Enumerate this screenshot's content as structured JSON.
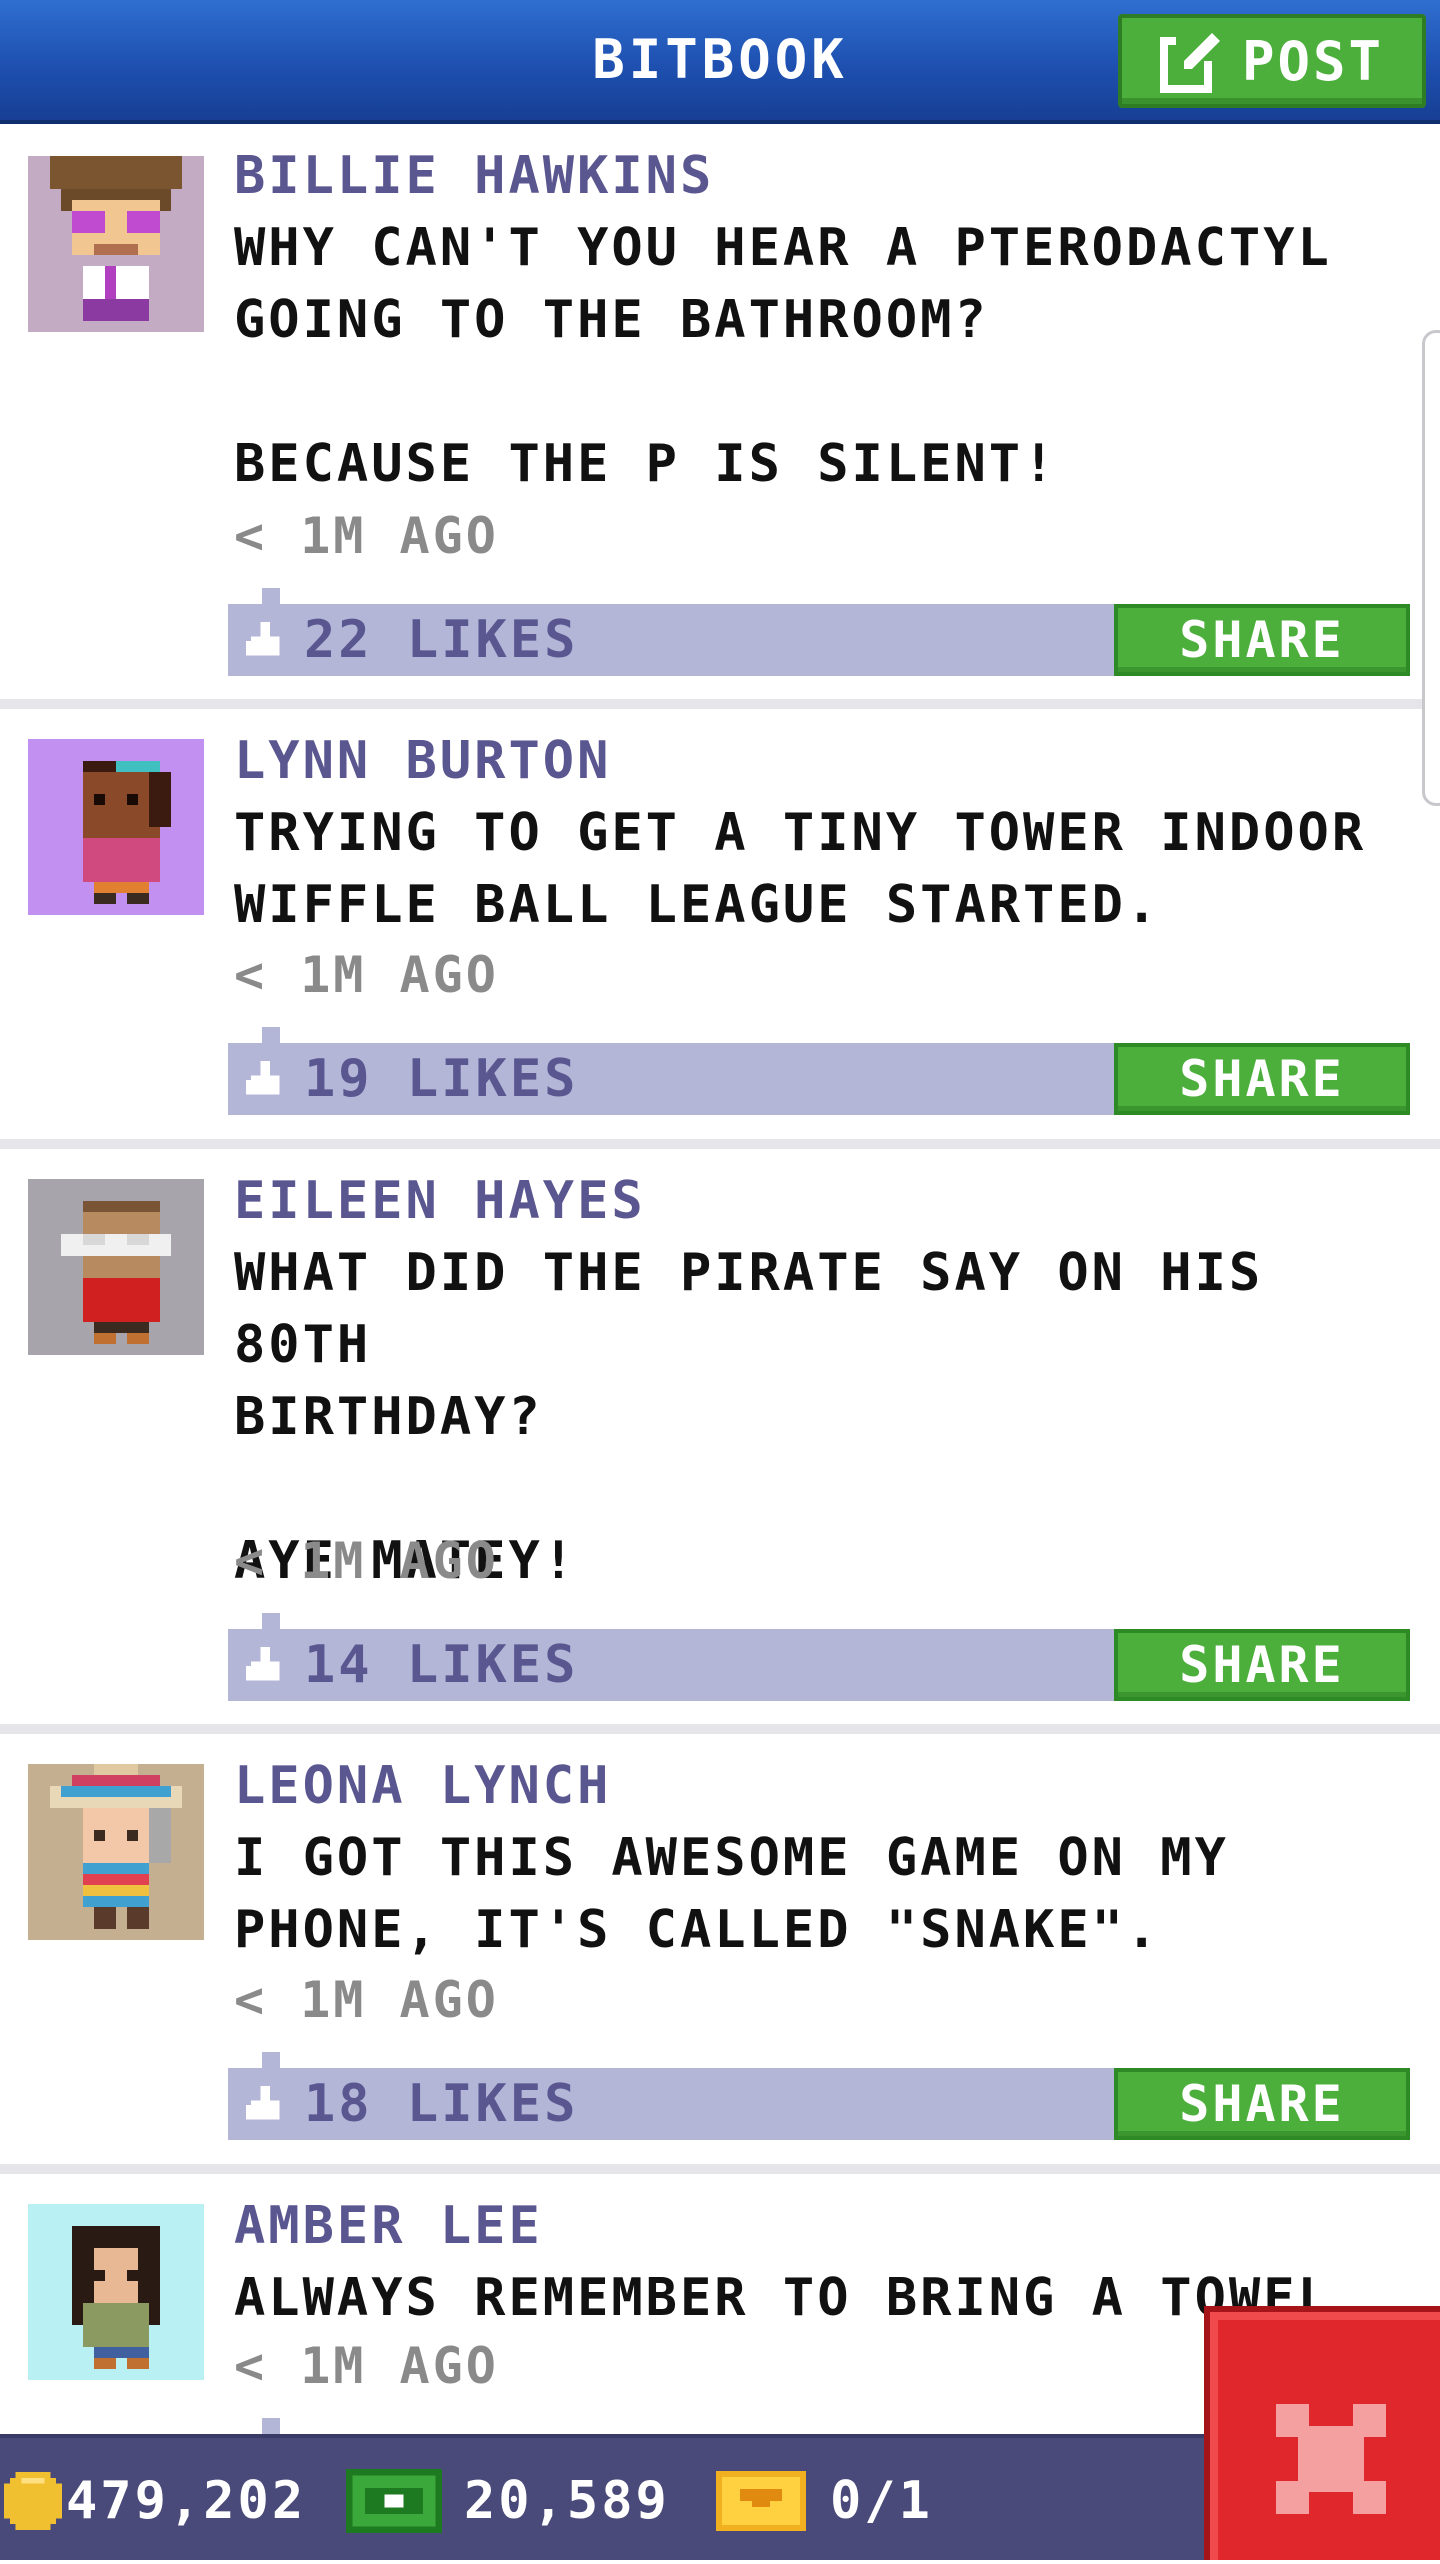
{
  "app": {
    "title": "BITBOOK",
    "post_label": "POST",
    "share_label": "SHARE",
    "colors": {
      "header": "#1e50b0",
      "accent_green": "#4caf3c",
      "like_bar": "#b4b6d8",
      "name": "#5a5690",
      "close": "#e0282c"
    }
  },
  "posts": [
    {
      "author": "BILLIE HAWKINS",
      "message": "WHY CAN'T YOU HEAR A PTERODACTYL\nGOING TO THE BATHROOM?\n\nBECAUSE THE P IS SILENT!",
      "time": "< 1M AGO",
      "likes": "22 LIKES",
      "avatar_icon": "billie-avatar"
    },
    {
      "author": "LYNN BURTON",
      "message": "TRYING TO GET A TINY TOWER INDOOR\nWIFFLE BALL LEAGUE STARTED.",
      "time": "< 1M AGO",
      "likes": "19 LIKES",
      "avatar_icon": "lynn-avatar"
    },
    {
      "author": "EILEEN HAYES",
      "message": "WHAT DID THE PIRATE SAY ON HIS 80TH\nBIRTHDAY?\n\nAYE MATEY!",
      "time": "< 1M AGO",
      "likes": "14 LIKES",
      "avatar_icon": "eileen-avatar"
    },
    {
      "author": "LEONA LYNCH",
      "message": "I GOT THIS AWESOME GAME ON MY\nPHONE, IT'S CALLED \"SNAKE\".",
      "time": "< 1M AGO",
      "likes": "18 LIKES",
      "avatar_icon": "leona-avatar"
    },
    {
      "author": "AMBER LEE",
      "message": "ALWAYS REMEMBER TO BRING A TOWEL",
      "time": "< 1M AGO",
      "likes": "",
      "avatar_icon": "amber-avatar"
    }
  ],
  "status": {
    "coins": "479,202",
    "bux": "20,589",
    "tickets": "0/1"
  }
}
